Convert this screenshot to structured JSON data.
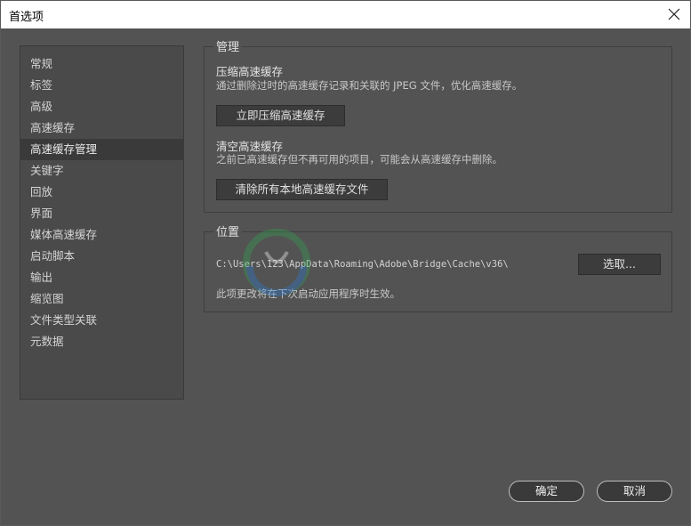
{
  "window": {
    "title": "首选项"
  },
  "sidebar": {
    "items": [
      {
        "label": "常规"
      },
      {
        "label": "标签"
      },
      {
        "label": "高级"
      },
      {
        "label": "高速缓存"
      },
      {
        "label": "高速缓存管理",
        "selected": true
      },
      {
        "label": "关键字"
      },
      {
        "label": "回放"
      },
      {
        "label": "界面"
      },
      {
        "label": "媒体高速缓存"
      },
      {
        "label": "启动脚本"
      },
      {
        "label": "输出"
      },
      {
        "label": "缩览图"
      },
      {
        "label": "文件类型关联"
      },
      {
        "label": "元数据"
      }
    ]
  },
  "manage": {
    "title": "管理",
    "compact_heading": "压缩高速缓存",
    "compact_desc": "通过删除过时的高速缓存记录和关联的 JPEG 文件，优化高速缓存。",
    "compact_button": "立即压缩高速缓存",
    "purge_heading": "清空高速缓存",
    "purge_desc": "之前已高速缓存但不再可用的项目，可能会从高速缓存中删除。",
    "purge_button": "清除所有本地高速缓存文件"
  },
  "location": {
    "title": "位置",
    "path": "C:\\Users\\123\\AppData\\Roaming\\Adobe\\Bridge\\Cache\\v36\\",
    "choose_button": "选取...",
    "note": "此项更改将在下次启动应用程序时生效。"
  },
  "footer": {
    "ok_label": "确定",
    "cancel_label": "取消"
  },
  "colors": {
    "background": "#535353",
    "sidebar_selected": "#3a3a3a",
    "watermark_green": "#2fa84f",
    "watermark_blue": "#2d7bd6"
  },
  "icons": {
    "close": "close-icon",
    "watermark": "watermark-logo-icon"
  }
}
